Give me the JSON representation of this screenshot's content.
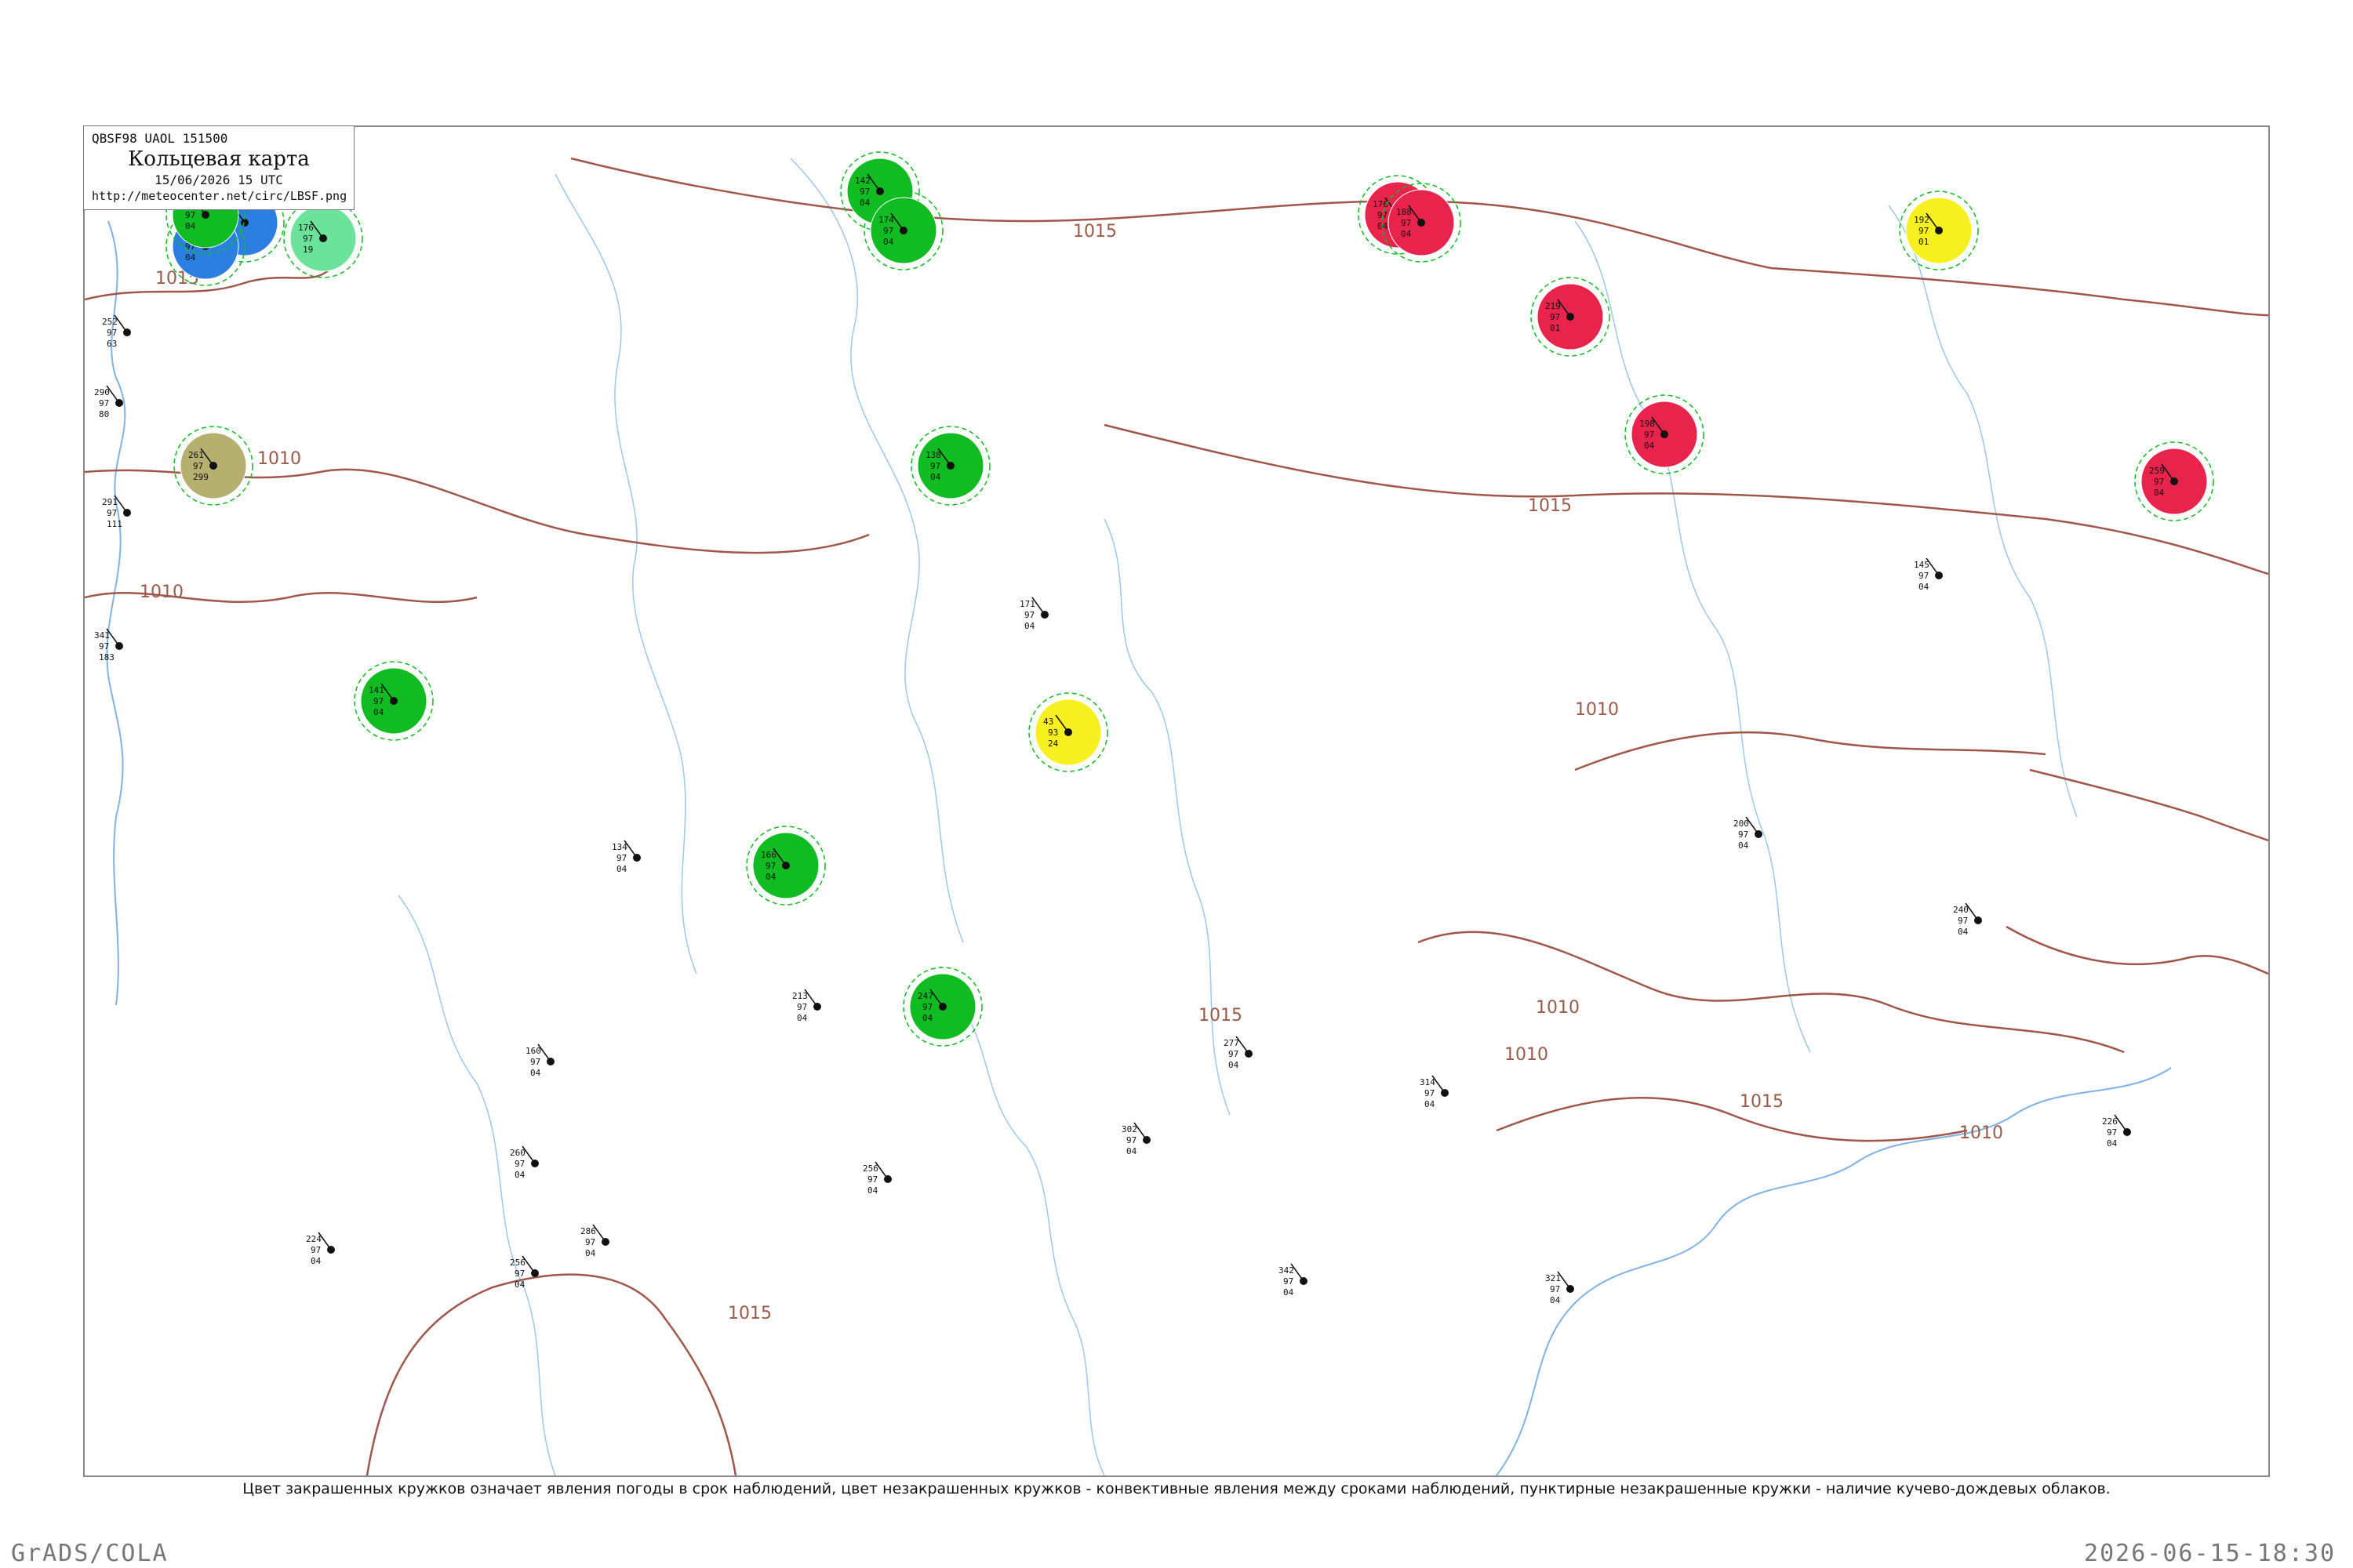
{
  "header": {
    "code_line": "QBSF98  UAOL  151500",
    "title": "Кольцевая карта",
    "datetime": "15/06/2026 15 UTC",
    "url": "http://meteocenter.net/circ/LBSF.png"
  },
  "footnote": "Цвет закрашенных кружков означает явления погоды в срок наблюдений, цвет незакрашенных кружков - конвективные явления между сроками наблюдений, пунктирные незакрашенные кружки - наличие кучево-дождевых облаков.",
  "brand": "GrADS/COLA",
  "timestamp": "2026-06-15-18:30",
  "colors": {
    "rain": "#11bb22",
    "thunder": "#e8244c",
    "fog": "#f6f021",
    "snow": "#2a7fe0",
    "haze": "#b5b070",
    "drizzle": "#6be39a",
    "isobar": "#a0574a",
    "coast": "#7fb2e6",
    "river": "#9cc7ee"
  },
  "isobars": [
    {
      "label": "1015"
    },
    {
      "label": "1015"
    },
    {
      "label": "1010"
    },
    {
      "label": "1010"
    },
    {
      "label": "1015"
    },
    {
      "label": "1010"
    },
    {
      "label": "1010"
    },
    {
      "label": "1015"
    },
    {
      "label": "1015"
    },
    {
      "label": "1015"
    },
    {
      "label": "1010"
    },
    {
      "label": "1010"
    }
  ],
  "stations": [
    {
      "p": "252",
      "t": "97",
      "d": "63",
      "kind": "none"
    },
    {
      "p": "290",
      "t": "97",
      "d": "80",
      "kind": "none"
    },
    {
      "p": "291",
      "t": "97",
      "d": "111",
      "kind": "none"
    },
    {
      "p": "341",
      "t": "97",
      "d": "183",
      "kind": "none"
    },
    {
      "p": "261",
      "t": "97",
      "d": "299",
      "kind": "haze"
    },
    {
      "p": "160",
      "t": "97",
      "d": "03",
      "kind": "snow"
    },
    {
      "p": "176",
      "t": "97",
      "d": "19",
      "kind": "drizzle"
    },
    {
      "p": "136",
      "t": "97",
      "d": "04",
      "kind": "snow"
    },
    {
      "p": "163",
      "t": "97",
      "d": "04",
      "kind": "rain"
    },
    {
      "p": "138",
      "t": "97",
      "d": "04",
      "kind": "rain"
    },
    {
      "p": "142",
      "t": "97",
      "d": "04",
      "kind": "rain"
    },
    {
      "p": "174",
      "t": "97",
      "d": "04",
      "kind": "rain"
    },
    {
      "p": "176",
      "t": "97",
      "d": "04",
      "kind": "thunder"
    },
    {
      "p": "188",
      "t": "97",
      "d": "04",
      "kind": "thunder"
    },
    {
      "p": "219",
      "t": "97",
      "d": "01",
      "kind": "thunder"
    },
    {
      "p": "192",
      "t": "97",
      "d": "01",
      "kind": "fog"
    },
    {
      "p": "198",
      "t": "97",
      "d": "04",
      "kind": "thunder"
    },
    {
      "p": "259",
      "t": "97",
      "d": "04",
      "kind": "thunder"
    },
    {
      "p": "43",
      "t": "93",
      "d": "24",
      "kind": "fog"
    },
    {
      "p": "166",
      "t": "97",
      "d": "04",
      "kind": "rain"
    },
    {
      "p": "141",
      "t": "97",
      "d": "04",
      "kind": "rain"
    },
    {
      "p": "247",
      "t": "97",
      "d": "04",
      "kind": "rain"
    },
    {
      "p": "171",
      "t": "97",
      "d": "04",
      "kind": "none"
    },
    {
      "p": "256",
      "t": "97",
      "d": "04",
      "kind": "none"
    },
    {
      "p": "286",
      "t": "97",
      "d": "04",
      "kind": "none"
    },
    {
      "p": "224",
      "t": "97",
      "d": "04",
      "kind": "none"
    },
    {
      "p": "160",
      "t": "97",
      "d": "04",
      "kind": "none"
    },
    {
      "p": "145",
      "t": "97",
      "d": "04",
      "kind": "none"
    },
    {
      "p": "302",
      "t": "97",
      "d": "04",
      "kind": "none"
    },
    {
      "p": "342",
      "t": "97",
      "d": "04",
      "kind": "none"
    },
    {
      "p": "321",
      "t": "97",
      "d": "04",
      "kind": "none"
    },
    {
      "p": "277",
      "t": "97",
      "d": "04",
      "kind": "none"
    },
    {
      "p": "213",
      "t": "97",
      "d": "04",
      "kind": "none"
    },
    {
      "p": "260",
      "t": "97",
      "d": "04",
      "kind": "none"
    },
    {
      "p": "200",
      "t": "97",
      "d": "04",
      "kind": "none"
    },
    {
      "p": "256",
      "t": "97",
      "d": "04",
      "kind": "none"
    },
    {
      "p": "314",
      "t": "97",
      "d": "04",
      "kind": "none"
    },
    {
      "p": "240",
      "t": "97",
      "d": "04",
      "kind": "none"
    },
    {
      "p": "226",
      "t": "97",
      "d": "04",
      "kind": "none"
    },
    {
      "p": "134",
      "t": "97",
      "d": "04",
      "kind": "none"
    }
  ]
}
